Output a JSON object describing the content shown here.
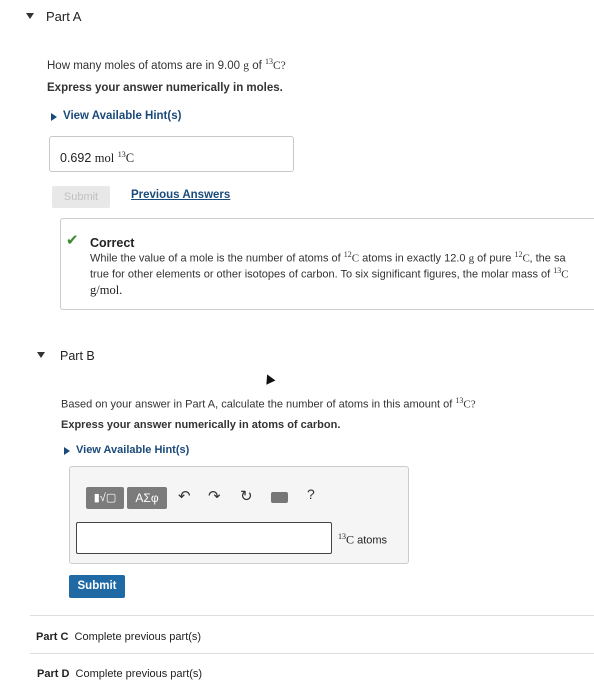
{
  "part_a": {
    "title": "Part A",
    "question_prefix": "How many moles of atoms are in 9.00",
    "question_unit": "g",
    "question_of": "of",
    "question_isotope_sup": "13",
    "question_isotope_el": "C?",
    "instruction": "Express your answer numerically in moles.",
    "hint_label": "View Available Hint(s)",
    "answer_value": "0.692",
    "answer_unit": "mol",
    "answer_sup": "13",
    "answer_el": "C",
    "submit_label": "Submit",
    "previous_answers_label": "Previous Answers",
    "correct": {
      "title": "Correct",
      "line1_a": "While the value of a mole is the number of atoms of",
      "line1_sup1": "12",
      "line1_c1": "C",
      "line1_b": "atoms in exactly 12.0",
      "line1_g": "g",
      "line1_c": "of pure",
      "line1_sup2": "12",
      "line1_c2": "C,",
      "line1_d": "the sa",
      "line2_a": "true for other elements or other isotopes of carbon. To six significant figures, the molar mass of",
      "line2_sup": "13",
      "line2_c": "C",
      "line3": "g/mol."
    }
  },
  "part_b": {
    "title": "Part B",
    "question_prefix": "Based on your answer in Part A, calculate the number of atoms in this amount of",
    "question_sup": "13",
    "question_el": "C?",
    "instruction": "Express your answer numerically in atoms of carbon.",
    "hint_label": "View Available Hint(s)",
    "toolbar": {
      "template_label": "▮√▢",
      "greek_label": "ΑΣφ",
      "help_label": "?"
    },
    "unit_sup": "13",
    "unit_el": "C",
    "unit_word": "atoms",
    "submit_label": "Submit"
  },
  "part_c": {
    "title": "Part C",
    "status": "Complete previous part(s)"
  },
  "part_d": {
    "title": "Part D",
    "status": "Complete previous part(s)"
  }
}
